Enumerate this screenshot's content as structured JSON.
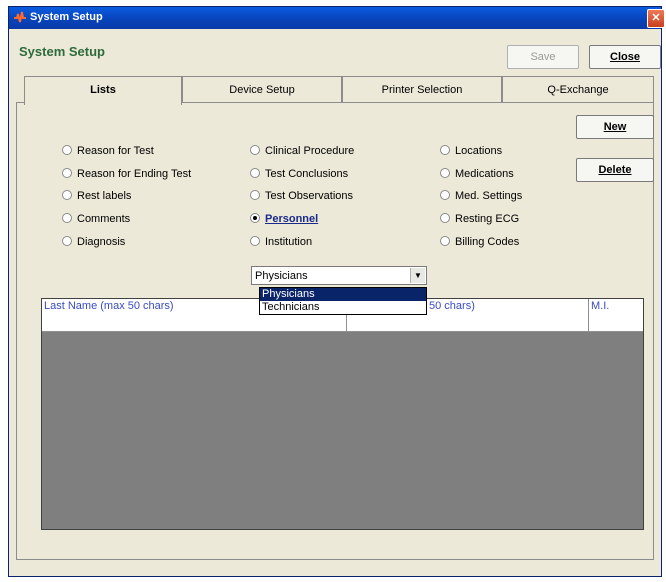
{
  "window": {
    "title": "System Setup"
  },
  "header": {
    "title": "System Setup",
    "save_label": "Save",
    "close_label": "Close"
  },
  "tabs": [
    {
      "label": "Lists"
    },
    {
      "label": "Device Setup"
    },
    {
      "label": "Printer Selection"
    },
    {
      "label": "Q-Exchange"
    }
  ],
  "actions": {
    "new_label": "New",
    "delete_label": "Delete"
  },
  "radios": {
    "col1": [
      "Reason for Test",
      "Reason for Ending Test",
      "Rest labels",
      "Comments",
      "Diagnosis"
    ],
    "col2": [
      "Clinical Procedure",
      "Test Conclusions",
      "Test Observations",
      "Personnel",
      "Institution"
    ],
    "col3": [
      "Locations",
      "Medications",
      "Med. Settings",
      "Resting ECG",
      "Billing Codes"
    ],
    "selected": "Personnel"
  },
  "personnel_type": {
    "value": "Physicians",
    "options": [
      "Physicians",
      "Technicians"
    ]
  },
  "table": {
    "columns": [
      "Last Name (max 50 chars)",
      "50 chars)",
      "M.I."
    ]
  },
  "colors": {
    "heading": "#2e6b3a",
    "selection": "#0a246a",
    "grid_bg": "#7f7f7f",
    "column_header_text": "#3a4cc0"
  }
}
